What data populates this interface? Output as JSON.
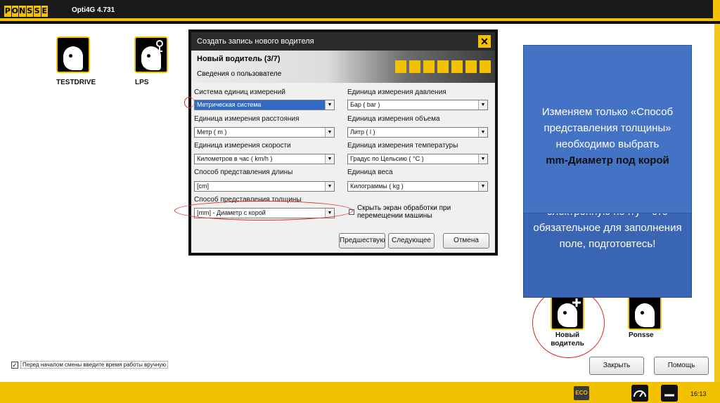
{
  "app": {
    "logo_letters": [
      "P",
      "O",
      "N",
      "S",
      "S",
      "E"
    ],
    "title": "Opti4G 4.731"
  },
  "left_tiles": [
    {
      "label": "TESTDRIVE",
      "icon": "driver-face-icon"
    },
    {
      "label": "LPS",
      "icon": "driver-key-icon"
    }
  ],
  "right_tiles": [
    {
      "label": "Новый водитель",
      "icon": "new-driver-icon"
    },
    {
      "label": "Ponsse",
      "icon": "driver-face-icon"
    }
  ],
  "dialog": {
    "title": "Создать запись нового водителя",
    "step": "Новый водитель (3/7)",
    "section": "Сведения о пользователе",
    "left_fields": [
      {
        "label": "Система единиц измерений",
        "value": "Метрическая система"
      },
      {
        "label": "Единица измерения расстояния",
        "value": "Метр ( m )"
      },
      {
        "label": "Единица измерения скорости",
        "value": "Километров в час ( km/h )"
      },
      {
        "label": "Способ представления длины",
        "value": "[cm]"
      },
      {
        "label": "Способ представления толщины",
        "value": "[mm] - Диаметр с корой"
      }
    ],
    "right_fields": [
      {
        "label": "Единица измерения давления",
        "value": "Бар ( bar )"
      },
      {
        "label": "Единица измерения объема",
        "value": "Литр ( l )"
      },
      {
        "label": "Единица измерения температуры",
        "value": "Градус по Цельсию ( °C )"
      },
      {
        "label": "Единица веса",
        "value": "Килограммы ( kg )"
      }
    ],
    "hide_screen_checkbox": "Скрыть экран обработки при перемещении машины",
    "buttons": {
      "prev": "Предшествующий",
      "next": "Следующее",
      "cancel": "Отмена"
    }
  },
  "callout": {
    "front_line1": "Изменяем только «Способ представления толщины» необходимо выбрать",
    "front_bold": "mm-Диаметр под корой",
    "back_text": "электронную почту – это обязательное для заполнения поле, подготовтесь!"
  },
  "bottom": {
    "manual_time_checkbox": "Перед началом смены введите время работы вручную",
    "close_button": "Закрыть",
    "help_button": "Помощь",
    "eco": "ECO",
    "clock": "16:13"
  },
  "colors": {
    "brand_yellow": "#f2c200",
    "callout_blue": "#4472c4",
    "highlight_red": "#d22222"
  }
}
